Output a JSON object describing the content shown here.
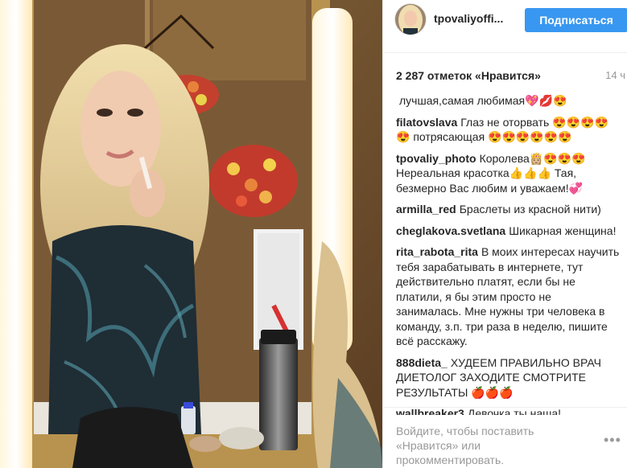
{
  "photo": {
    "alt": "Photo"
  },
  "header": {
    "username": "tpovaliyoffi...",
    "follow_label": "Подписаться"
  },
  "meta": {
    "likes": "2 287 отметок «Нравится»",
    "time": "14 ч"
  },
  "comments": [
    {
      "user": "",
      "text": "лучшая,самая любимая💖💋😍"
    },
    {
      "user": "filatovslava",
      "text": "Глаз не оторвать 😍😍😍😍😍 потрясающая 😍😍😍😍😍😍"
    },
    {
      "user": "tpovaliy_photo",
      "text": "Королева👸🏼😍😍😍 Нереальная красотка👍👍👍 Тая, безмерно Вас любим и уважаем!💞"
    },
    {
      "user": "armilla_red",
      "text": "Браслеты из красной нити)"
    },
    {
      "user": "cheglakova.svetlana",
      "text": "Шикарная женщина!"
    },
    {
      "user": "rita_rabota_rita",
      "text": "В моих интересах научить тебя зарабатывать в интернете, тут действительно платят, если бы не платили, я бы этим просто не занималась. Мне нужны три человека в команду, з.п. три раза в неделю, пишите всё расскажу."
    },
    {
      "user": "888dieta_",
      "text": "ХУДЕЕМ ПРАВИЛЬНО ВРАЧ ДИЕТОЛОГ ЗАХОДИТЕ СМОТРИТЕ РЕЗУЛЬТАТЫ 🍎🍎🍎"
    },
    {
      "user": "wallbreaker3",
      "text": "Девочка ты наша!"
    }
  ],
  "footer": {
    "login_link": "Войдите",
    "login_text": ", чтобы поставить «Нравится» или прокомментировать.",
    "more_icon": "more-options-icon",
    "more_glyph": "•••"
  },
  "colors": {
    "accent": "#3897f0",
    "text": "#262626",
    "muted": "#999999",
    "border": "#efefef"
  }
}
